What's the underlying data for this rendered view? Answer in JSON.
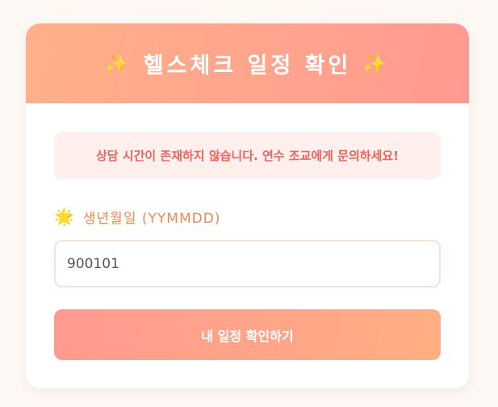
{
  "header": {
    "sparkle_left": "✨",
    "title": "헬스체크 일정 확인",
    "sparkle_right": "✨"
  },
  "alert": {
    "message": "상담 시간이 존재하지 않습니다. 연수 조교에게 문의하세요!"
  },
  "birth_field": {
    "icon": "🌟",
    "label": "생년월일 (YYMMDD)",
    "value": "900101"
  },
  "submit": {
    "label": "내 일정 확인하기"
  },
  "colors": {
    "header_gradient_start": "#ffb08a",
    "header_gradient_end": "#ff9a90",
    "alert_background": "#fff0ee",
    "alert_text": "#f0645e",
    "label_text": "#f08a55",
    "button_gradient_start": "#ff9a90",
    "button_gradient_end": "#ffae82"
  }
}
